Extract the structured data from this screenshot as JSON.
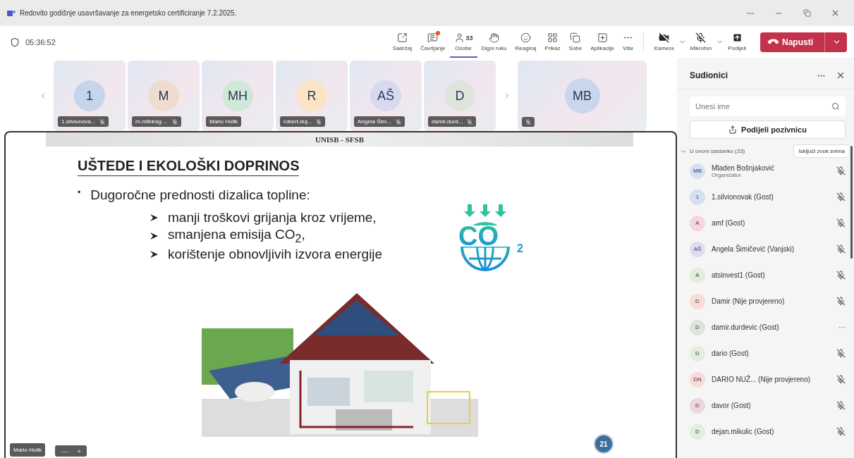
{
  "window": {
    "title": "Redovito godišnje usavršavanje za energetsko certificiranje 7.2.2025."
  },
  "meeting": {
    "timer": "05:36:52"
  },
  "toolbar": {
    "items": [
      {
        "label": "Sadržaj",
        "selected": false,
        "notification": false
      },
      {
        "label": "Čavrljanje",
        "selected": false,
        "notification": true
      },
      {
        "label": "Osobe",
        "selected": true,
        "notification": false,
        "count": "33"
      },
      {
        "label": "Digni ruku",
        "selected": false,
        "notification": false
      },
      {
        "label": "Reagiraj",
        "selected": false,
        "notification": false
      },
      {
        "label": "Prikaz",
        "selected": false,
        "notification": false
      },
      {
        "label": "Sobe",
        "selected": false,
        "notification": false
      },
      {
        "label": "Aplikacije",
        "selected": false,
        "notification": false
      },
      {
        "label": "Više",
        "selected": false,
        "notification": false
      }
    ],
    "devices": [
      {
        "label": "Kamera",
        "off": true
      },
      {
        "label": "Mikrofon",
        "off": true
      },
      {
        "label": "Podijeli"
      }
    ],
    "leave": "Napusti"
  },
  "tiles": [
    {
      "initials": "1",
      "name": "1.silvionova...",
      "color": "#c6d4ec",
      "muted": true
    },
    {
      "initials": "M",
      "name": "m.milidrag ...",
      "color": "#eedccf",
      "muted": true
    },
    {
      "initials": "MH",
      "name": "Mario Holik",
      "color": "#cfe8d8",
      "muted": false
    },
    {
      "initials": "R",
      "name": "robert.duj...",
      "color": "#fbe3c5",
      "muted": true
    },
    {
      "initials": "AŠ",
      "name": "Angela Šim...",
      "color": "#d8d8f0",
      "muted": true
    },
    {
      "initials": "D",
      "name": "damir.durd...",
      "color": "#dfe4dd",
      "muted": true
    }
  ],
  "featured_tile": {
    "initials": "MB",
    "color": "#c9d6ec",
    "muted": true
  },
  "slide": {
    "header": "UNISB - SFSB",
    "title": "UŠTEDE I EKOLOŠKI DOPRINOS",
    "bullet_mark": "•",
    "bullet": "Dugoročne prednosti dizalica topline:",
    "sub_bullets": [
      "manji troškovi grijanja kroz vrijeme,",
      "smanjena emisija CO$_{2}$,",
      "korištenje obnovljivih izvora energije"
    ],
    "logo": {
      "text": "CO",
      "sub": "2"
    },
    "page": "21"
  },
  "presenter": {
    "name": "Mario Holik",
    "zoom_out": "—",
    "zoom_in": "+"
  },
  "panel": {
    "title": "Sudionici",
    "search": {
      "placeholder": "Unesi ime"
    },
    "invite": "Podijeli pozivnicu",
    "section": {
      "label": "U ovom sastanku (33)",
      "expanded": true,
      "action": "Isključi zvuk svima"
    },
    "participants": [
      {
        "initials": "MB",
        "name": "Mladen Bošnjaković",
        "role": "Organizator",
        "color": "#d6e0f2",
        "muted": true
      },
      {
        "initials": "1",
        "name": "1.silvionovak (Gost)",
        "color": "#d6e0f2",
        "muted": true
      },
      {
        "initials": "A",
        "name": "amf (Gost)",
        "color": "#f7d5de",
        "muted": true
      },
      {
        "initials": "AŠ",
        "name": "Angela Šimičević (Vanjski)",
        "color": "#dedcf2",
        "muted": true
      },
      {
        "initials": "A",
        "name": "atsinvest1 (Gost)",
        "color": "#e2eddb",
        "muted": true
      },
      {
        "initials": "D",
        "name": "Damir (Nije provjereno)",
        "color": "#fadad4",
        "muted": true
      },
      {
        "initials": "D",
        "name": "damir.durdevic (Gost)",
        "color": "#dce4db",
        "menu": "···"
      },
      {
        "initials": "D",
        "name": "dario (Gost)",
        "color": "#e4eedc",
        "muted": true
      },
      {
        "initials": "DN",
        "name": "DARIO NUŽ...  (Nije provjereno)",
        "color": "#fadad4",
        "muted": true
      },
      {
        "initials": "D",
        "name": "davor (Gost)",
        "color": "#eed5de",
        "muted": true
      },
      {
        "initials": "D",
        "name": "dejan.mikulic (Gost)",
        "color": "#e4eedc",
        "muted": true
      }
    ]
  }
}
